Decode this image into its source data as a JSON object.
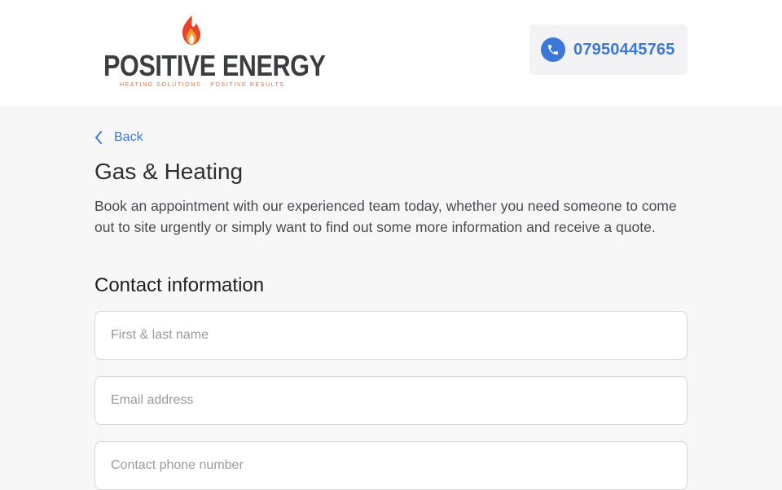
{
  "brand": {
    "name": "POSITIVE ENERGY",
    "tagline": "HEATING SOLUTIONS · POSITIVE RESULTS",
    "flame_colors": [
      "#e8432b",
      "#f29a2e"
    ],
    "wordmark_color": "#3b3d40"
  },
  "header": {
    "phone_number": "07950445765",
    "phone_icon": "phone-icon"
  },
  "nav": {
    "back_label": "Back",
    "back_icon": "chevron-left-icon"
  },
  "page": {
    "title": "Gas & Heating",
    "description": "Book an appointment with our experienced team today, whether you need someone to come out to site urgently or simply want to find out some more information and receive a quote."
  },
  "form": {
    "section_title": "Contact information",
    "name_placeholder": "First & last name",
    "email_placeholder": "Email address",
    "phone_placeholder": "Contact phone number"
  },
  "colors": {
    "accent": "#3b78d8",
    "background": "#f7f7f8",
    "header_bg": "#ffffff"
  }
}
